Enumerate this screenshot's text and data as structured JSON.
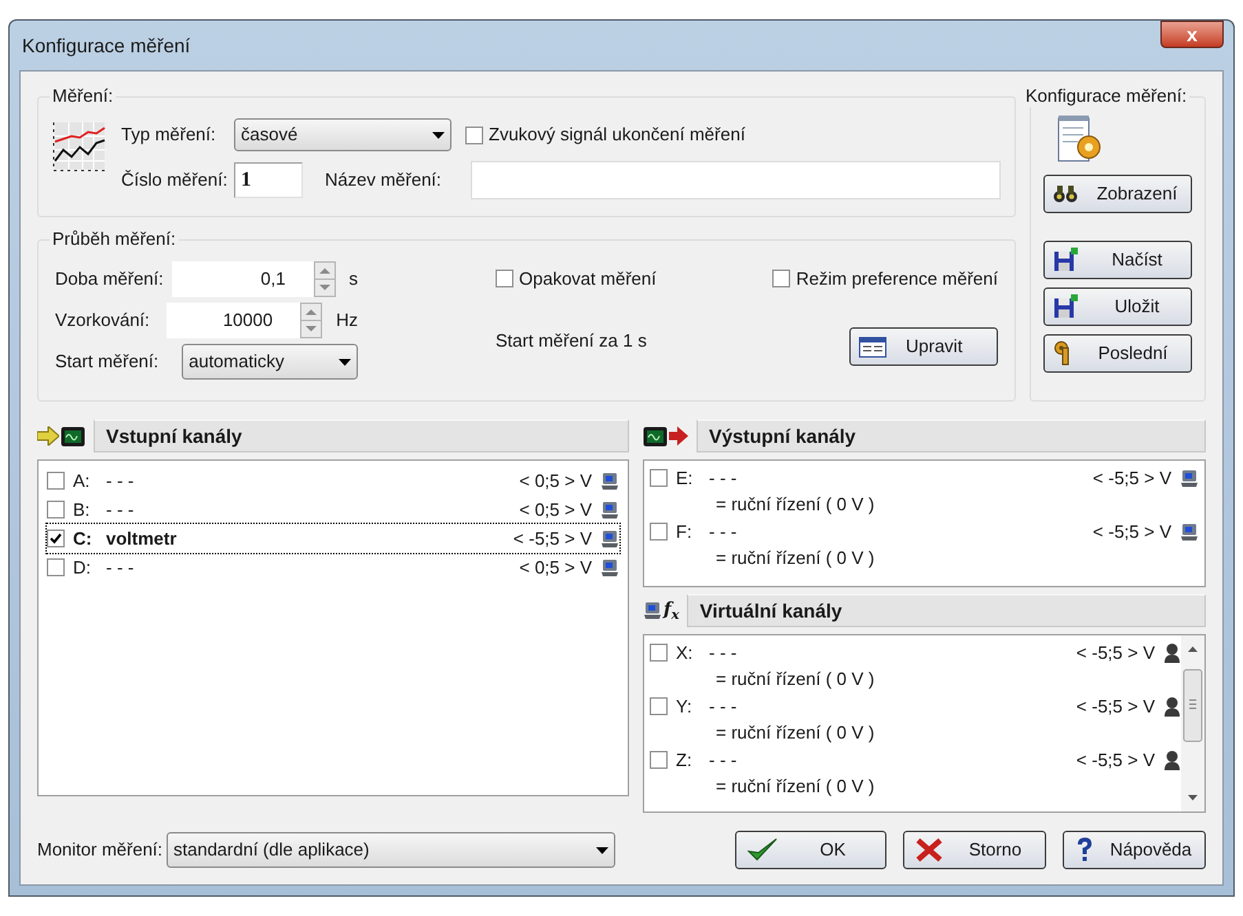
{
  "window": {
    "title": "Konfigurace měření",
    "close": "x"
  },
  "measurement": {
    "group_label": "Měření:",
    "type_label": "Typ měření:",
    "type_value": "časové",
    "sound": {
      "label": "Zvukový signál ukončení měření",
      "checked": false
    },
    "number_label": "Číslo měření:",
    "number_value": "1",
    "name_label": "Název měření:"
  },
  "progress": {
    "group_label": "Průběh měření:",
    "duration_label": "Doba měření:",
    "duration_value": "0,1",
    "duration_unit": "s",
    "sampling_label": "Vzorkování:",
    "sampling_value": "10000",
    "sampling_unit": "Hz",
    "start_label": "Start měření:",
    "start_value": "automaticky",
    "repeat": {
      "label": "Opakovat měření",
      "checked": false
    },
    "preference": {
      "label": "Režim preference měření",
      "checked": false
    },
    "start_info": "Start měření za 1 s",
    "edit_button": "Upravit"
  },
  "config": {
    "label": "Konfigurace měření:",
    "buttons": [
      {
        "kind": "view",
        "label": "Zobrazení"
      },
      {
        "kind": "load",
        "label": "Načíst"
      },
      {
        "kind": "save",
        "label": "Uložit"
      },
      {
        "kind": "last",
        "label": "Poslední"
      }
    ]
  },
  "input_channels": {
    "title": "Vstupní kanály",
    "items": [
      {
        "id": "A:",
        "name": "- - -",
        "range": "< 0;5 > V",
        "checked": false,
        "focused": false
      },
      {
        "id": "B:",
        "name": "- - -",
        "range": "< 0;5 > V",
        "checked": false,
        "focused": false
      },
      {
        "id": "C:",
        "name": "voltmetr",
        "range": "< -5;5 > V",
        "checked": true,
        "focused": true
      },
      {
        "id": "D:",
        "name": "- - -",
        "range": "< 0;5 > V",
        "checked": false,
        "focused": false
      }
    ]
  },
  "output_channels": {
    "title": "Výstupní kanály",
    "items": [
      {
        "id": "E:",
        "name": "- - -",
        "range": "< -5;5 > V",
        "checked": false,
        "note": "= ruční řízení  ( 0 V )"
      },
      {
        "id": "F:",
        "name": "- - -",
        "range": "< -5;5 > V",
        "checked": false,
        "note": "= ruční řízení  ( 0 V )"
      }
    ]
  },
  "virtual_channels": {
    "title": "Virtuální kanály",
    "symbol": "f$_{x}$",
    "items": [
      {
        "id": "X:",
        "name": "- - -",
        "range": "< -5;5 > V",
        "checked": false,
        "note": "= ruční řízení  ( 0 V )"
      },
      {
        "id": "Y:",
        "name": "- - -",
        "range": "< -5;5 > V",
        "checked": false,
        "note": "= ruční řízení  ( 0 V )"
      },
      {
        "id": "Z:",
        "name": "- - -",
        "range": "< -5;5 > V",
        "checked": false,
        "note": "= ruční řízení  ( 0 V )"
      }
    ]
  },
  "monitor": {
    "label": "Monitor měření:",
    "value": "standardní (dle aplikace)"
  },
  "buttons": [
    {
      "kind": "ok",
      "label": "OK"
    },
    {
      "kind": "cancel",
      "label": "Storno"
    },
    {
      "kind": "help",
      "label": "Nápověda"
    }
  ]
}
